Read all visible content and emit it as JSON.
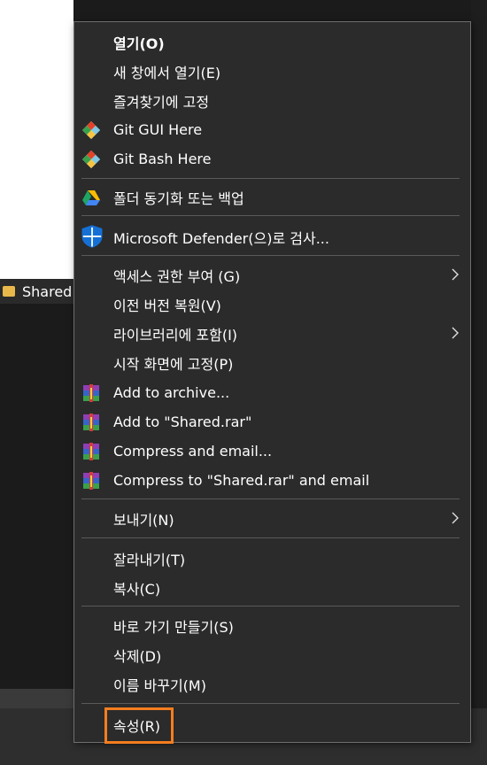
{
  "background": {
    "folder_label": "Shared"
  },
  "menu": {
    "items": [
      {
        "label": "열기(O)"
      },
      {
        "label": "새 창에서 열기(E)"
      },
      {
        "label": "즐겨찾기에 고정"
      },
      {
        "label": "Git GUI Here",
        "icon": "git-gui-icon"
      },
      {
        "label": "Git Bash Here",
        "icon": "git-bash-icon"
      },
      {
        "label": "폴더 동기화 또는 백업",
        "icon": "google-drive-icon"
      },
      {
        "label": "Microsoft Defender(으)로 검사...",
        "icon": "defender-shield-icon"
      },
      {
        "label": "액세스 권한 부여 (G)",
        "submenu": true
      },
      {
        "label": "이전 버전 복원(V)"
      },
      {
        "label": "라이브러리에 포함(I)",
        "submenu": true
      },
      {
        "label": "시작 화면에 고정(P)"
      },
      {
        "label": "Add to archive...",
        "icon": "winrar-icon"
      },
      {
        "label": "Add to \"Shared.rar\"",
        "icon": "winrar-icon"
      },
      {
        "label": "Compress and email...",
        "icon": "winrar-icon"
      },
      {
        "label": "Compress to \"Shared.rar\" and email",
        "icon": "winrar-icon"
      },
      {
        "label": "보내기(N)",
        "submenu": true
      },
      {
        "label": "잘라내기(T)"
      },
      {
        "label": "복사(C)"
      },
      {
        "label": "바로 가기 만들기(S)"
      },
      {
        "label": "삭제(D)"
      },
      {
        "label": "이름 바꾸기(M)"
      },
      {
        "label": "속성(R)"
      }
    ]
  },
  "colors": {
    "menu_bg": "#2b2b2b",
    "highlight": "#f57d1f",
    "text": "#ffffff"
  }
}
